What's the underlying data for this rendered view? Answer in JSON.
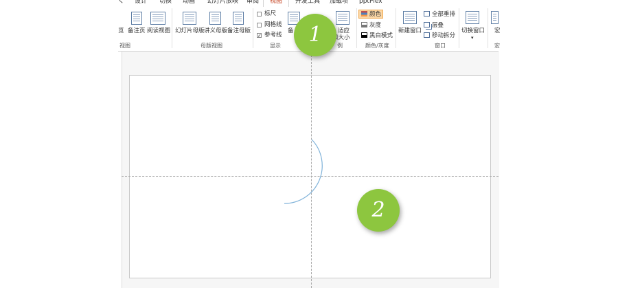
{
  "tabs": {
    "partial_left": "く",
    "design": "设计",
    "transitions": "切换",
    "animations": "动画",
    "slideshow": "幻灯片放映",
    "review": "审阅",
    "view": "视图",
    "developer": "开发工具",
    "addins": "加载项",
    "pptplex": "pptPlex"
  },
  "ribbon": {
    "presentation_views": {
      "partial_browse": "览",
      "notes_page": "备注页",
      "reading_view": "阅读视图",
      "group_label": "视图"
    },
    "master_views": {
      "slide_master": "幻灯片母版",
      "handout_master": "讲义母版",
      "notes_master": "备注母版",
      "group_label": "母版视图"
    },
    "show": {
      "ruler": "标尺",
      "gridlines": "网格线",
      "guides": "参考线",
      "ruler_checked": false,
      "gridlines_checked": false,
      "guides_checked": true,
      "partial_notes": "备",
      "group_label": "显示"
    },
    "zoom": {
      "fit_line1": "适应",
      "fit_line2": "口大小",
      "partial_group_label": "例"
    },
    "color": {
      "color": "颜色",
      "grayscale": "灰度",
      "black_white": "黑白模式",
      "group_label": "颜色/灰度"
    },
    "window": {
      "new_window": "新建窗口",
      "arrange_all": "全部重排",
      "cascade": "层叠",
      "move_split": "移动拆分",
      "group_label": "窗口"
    },
    "switch_window": {
      "label": "切换窗口",
      "partial_label": "宏",
      "partial_group": "宏"
    }
  },
  "callouts": {
    "step1": "1",
    "step2": "2"
  },
  "colors": {
    "active_tab": "#c43e1c",
    "badge": "#8dc63f",
    "arc": "#7fb2d9",
    "guide": "#a9a9a9"
  }
}
